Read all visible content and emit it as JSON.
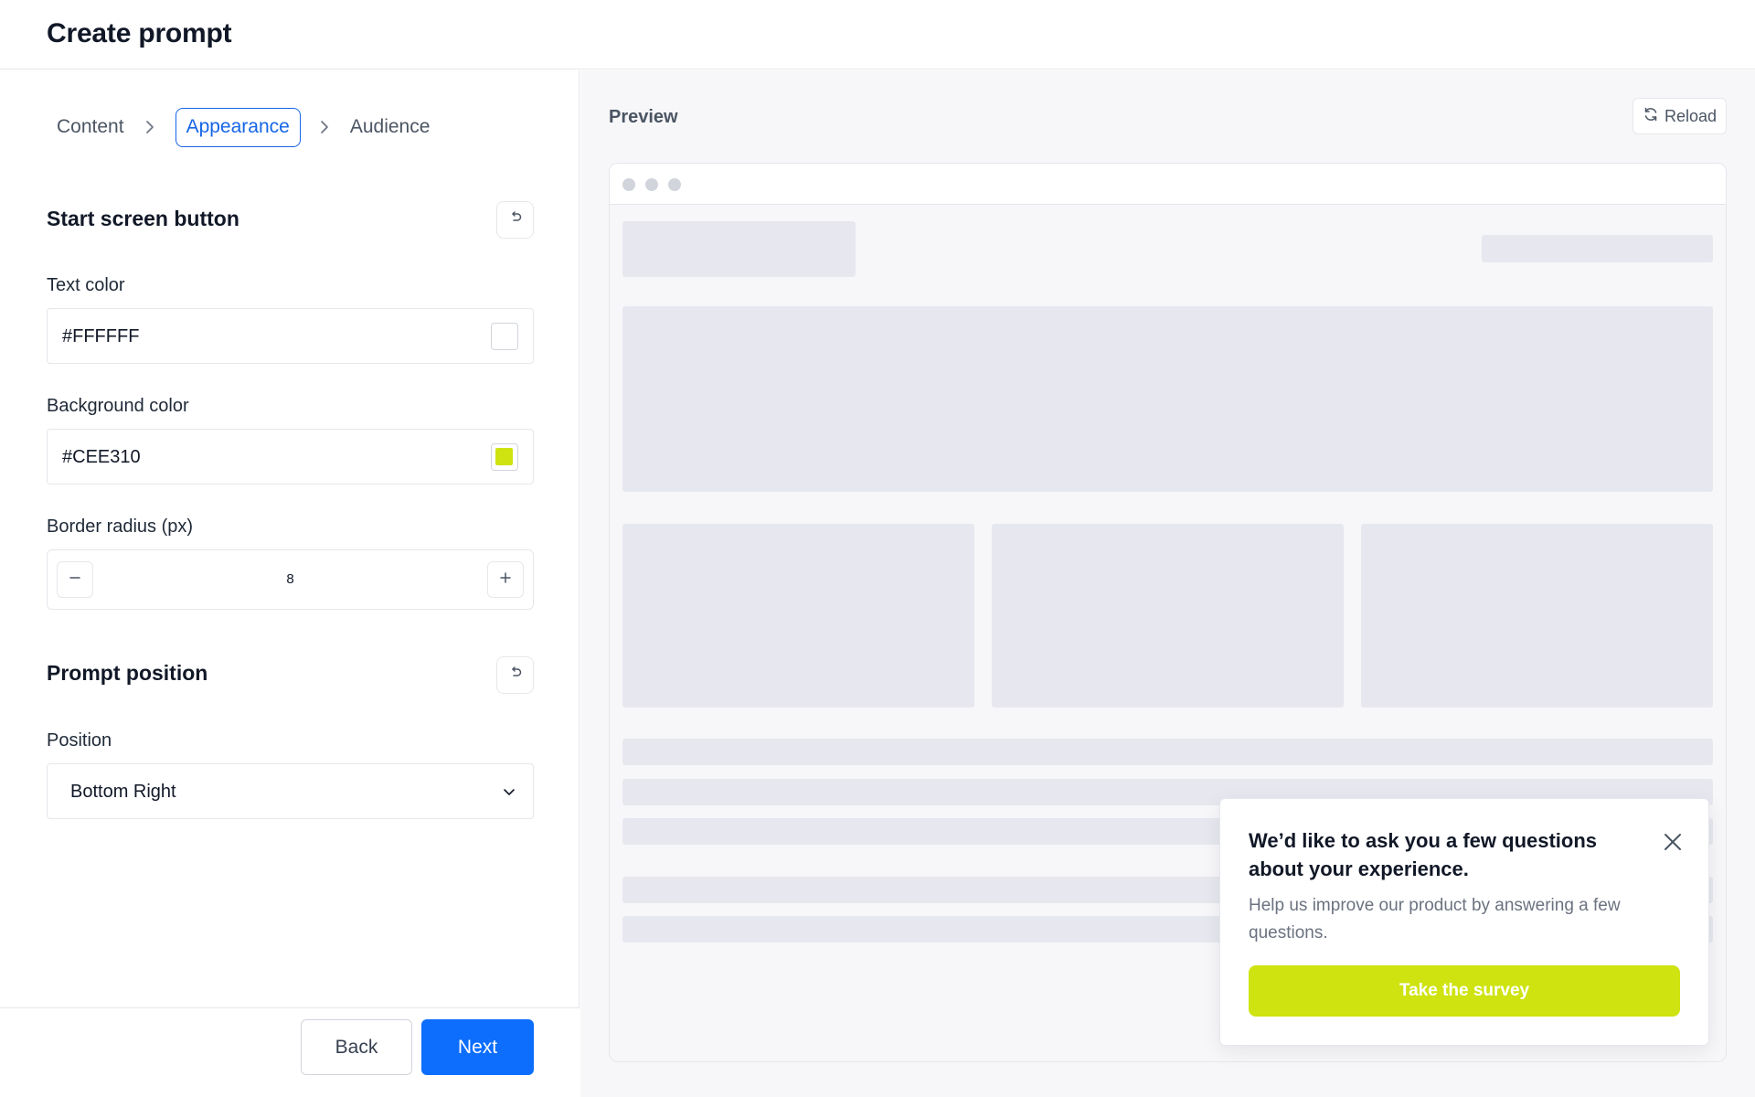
{
  "header": {
    "title": "Create prompt"
  },
  "stepper": {
    "steps": [
      {
        "label": "Content"
      },
      {
        "label": "Appearance"
      },
      {
        "label": "Audience"
      }
    ],
    "active_index": 1
  },
  "start_screen_button": {
    "title": "Start screen button",
    "reset_icon": "undo-icon",
    "text_color": {
      "label": "Text color",
      "value": "#FFFFFF",
      "swatch": "#FFFFFF"
    },
    "background_color": {
      "label": "Background color",
      "value": "#CEE310",
      "swatch": "#CEE310"
    },
    "border_radius": {
      "label": "Border radius (px)",
      "value": "8"
    }
  },
  "prompt_position": {
    "title": "Prompt position",
    "reset_icon": "undo-icon",
    "position": {
      "label": "Position",
      "value": "Bottom Right"
    }
  },
  "footer": {
    "back_label": "Back",
    "next_label": "Next"
  },
  "preview": {
    "title": "Preview",
    "reload_label": "Reload",
    "popup": {
      "title": "We’d like to ask you a few questions about your experience.",
      "body": "Help us improve our product by answering a few questions.",
      "cta_label": "Take the survey"
    }
  },
  "colors": {
    "primary": "#0D6EFD",
    "accent": "#CEE310",
    "border": "#E5E7EB",
    "skeleton": "#E7E8EF"
  }
}
